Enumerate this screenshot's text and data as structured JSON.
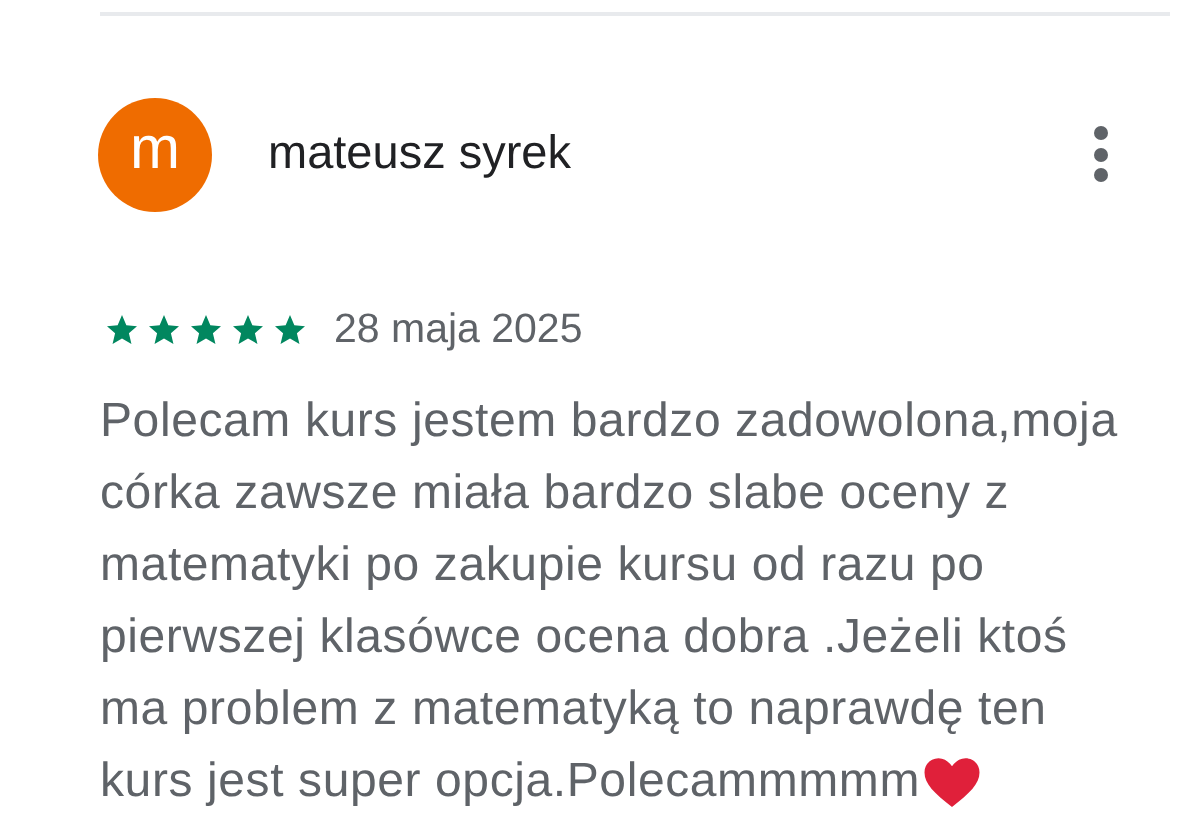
{
  "review": {
    "avatar_letter": "m",
    "author": "mateusz syrek",
    "stars": 5,
    "date": "28 maja 2025",
    "body_lines": [
      "Polecam kurs jestem bardzo zadowolona,moja",
      "córka zawsze miała bardzo slabe oceny z",
      "matematyki po zakupie kursu od razu po",
      "pierwszej klasówce ocena dobra .Jeżeli ktoś",
      "ma problem z matematyką to naprawdę ten",
      "kurs jest super opcja.Polecammmmm"
    ]
  }
}
